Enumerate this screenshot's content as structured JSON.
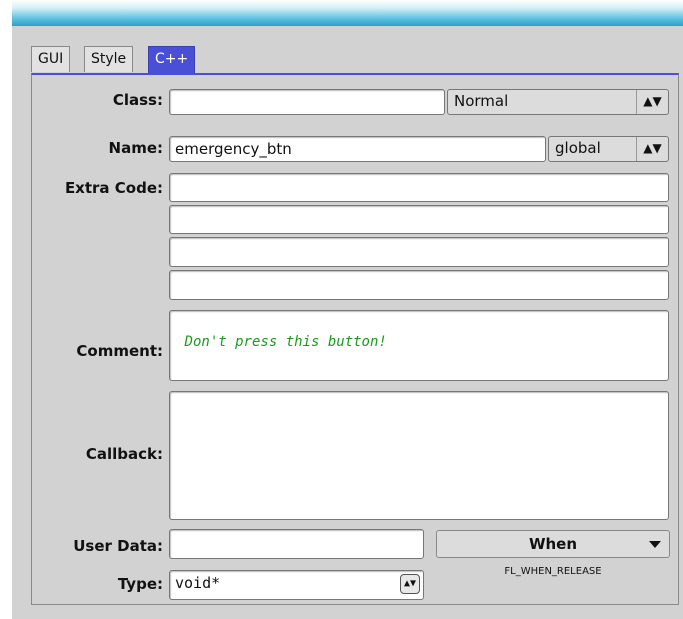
{
  "tabs": [
    {
      "label": "GUI"
    },
    {
      "label": "Style"
    },
    {
      "label": "C++"
    }
  ],
  "form": {
    "class_label": "Class:",
    "class_value": "",
    "class_mode": "Normal",
    "name_label": "Name:",
    "name_value": "emergency_btn",
    "name_scope": "global",
    "extra_code_label": "Extra Code:",
    "extra_code": [
      "",
      "",
      "",
      ""
    ],
    "comment_label": "Comment:",
    "comment_value": "Don't press this button!",
    "callback_label": "Callback:",
    "callback_value": "",
    "user_data_label": "User Data:",
    "user_data_value": "",
    "type_label": "Type:",
    "type_value": "void*",
    "when_label": "When",
    "when_value": "FL_WHEN_RELEASE"
  },
  "icons": {
    "spinner": "updown-arrows-icon",
    "dropdown": "chevron-down-icon"
  },
  "colors": {
    "active_tab": "#4a4fd8",
    "comment_text": "#1c9a1c",
    "titlebar": "#2f9fc6"
  }
}
